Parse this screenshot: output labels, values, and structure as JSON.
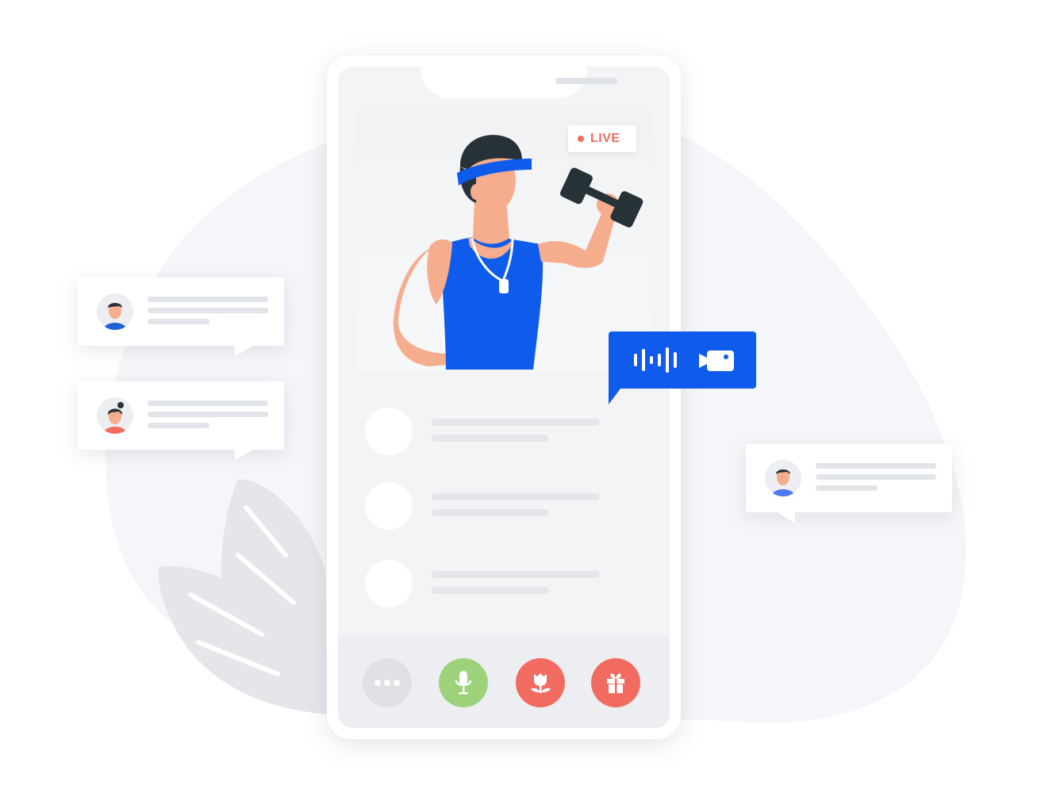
{
  "live_badge": {
    "label": "LIVE",
    "color": "#f26b61"
  },
  "colors": {
    "accent": "#0f5bec",
    "more_button": "#dfe1e5",
    "mic_button": "#9dd17a",
    "flower_button": "#f26b61",
    "gift_button": "#f26b61"
  },
  "controls": [
    {
      "icon": "more-icon"
    },
    {
      "icon": "microphone-icon"
    },
    {
      "icon": "flower-icon"
    },
    {
      "icon": "gift-icon"
    }
  ],
  "stream_bubble": {
    "icons": [
      "audio-wave-icon",
      "video-camera-icon"
    ]
  },
  "feed": {
    "item_count": 3
  },
  "chat_bubbles": [
    {
      "avatar": "male-avatar-icon",
      "shirt_color": "#1e63d8"
    },
    {
      "avatar": "female-avatar-icon",
      "shirt_color": "#f26b61"
    },
    {
      "avatar": "male-avatar-icon",
      "shirt_color": "#4e7bf0"
    }
  ]
}
